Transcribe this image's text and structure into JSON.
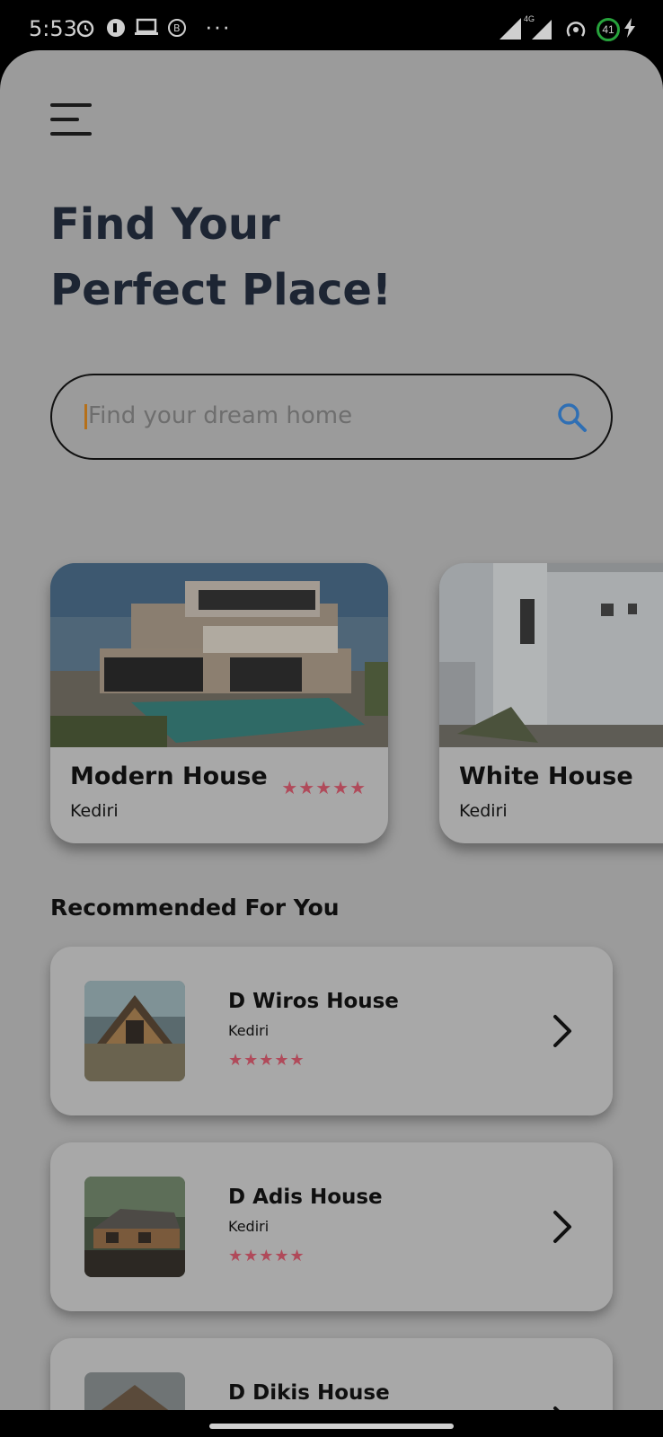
{
  "status_bar": {
    "time": "5:53",
    "network": "4G",
    "battery": "41",
    "more": "···"
  },
  "header": {
    "title_line1": "Find Your",
    "title_line2": "Perfect Place!"
  },
  "search": {
    "placeholder": "Find your dream home"
  },
  "featured": [
    {
      "name": "Modern House",
      "location": "Kediri",
      "rating": "★★★★★"
    },
    {
      "name": "White House",
      "location": "Kediri"
    }
  ],
  "recommended": {
    "title": "Recommended For You",
    "items": [
      {
        "name": "D Wiros House",
        "location": "Kediri",
        "rating": "★★★★★"
      },
      {
        "name": "D Adis House",
        "location": "Kediri",
        "rating": "★★★★★"
      },
      {
        "name": "D Dikis House"
      }
    ]
  },
  "colors": {
    "title": "#1d2533",
    "star": "#b04a5a",
    "search_icon": "#2f6fb4",
    "background_dim": "#9b9b9b"
  }
}
